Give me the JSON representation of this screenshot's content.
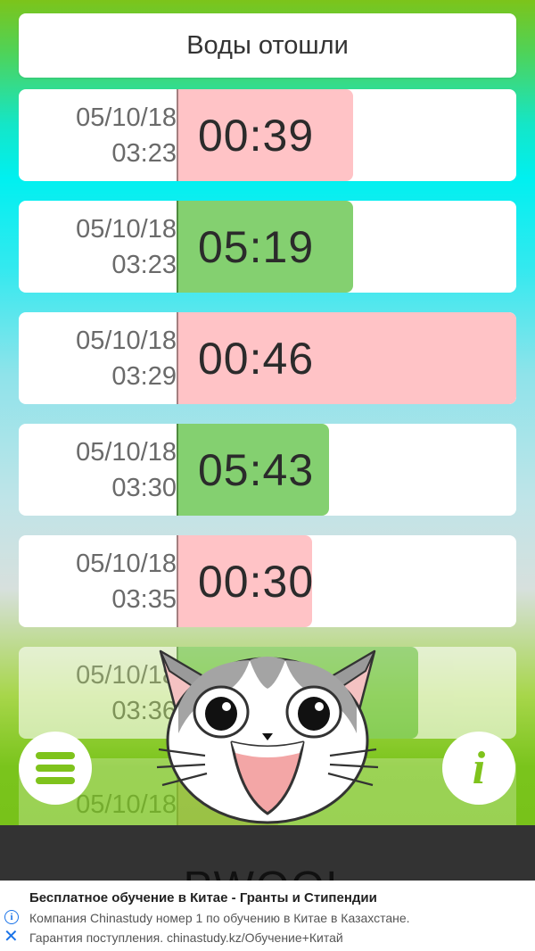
{
  "header": {
    "title": "Воды отошли"
  },
  "entries": [
    {
      "date": "05/10/18",
      "time": "03:23",
      "duration": "00:39",
      "type": "contraction",
      "fraction": 0.52
    },
    {
      "date": "05/10/18",
      "time": "03:23",
      "duration": "05:19",
      "type": "pause",
      "fraction": 0.52
    },
    {
      "date": "05/10/18",
      "time": "03:29",
      "duration": "00:46",
      "type": "contraction",
      "fraction": 1.0
    },
    {
      "date": "05/10/18",
      "time": "03:30",
      "duration": "05:43",
      "type": "pause",
      "fraction": 0.45
    },
    {
      "date": "05/10/18",
      "time": "03:35",
      "duration": "00:30",
      "type": "contraction",
      "fraction": 0.4
    },
    {
      "date": "05/10/18",
      "time": "03:36",
      "duration": "",
      "type": "pause",
      "fraction": 0.71
    },
    {
      "date": "05/10/18",
      "time": "",
      "duration": "",
      "type": "contraction",
      "fraction": 0.3
    }
  ],
  "controls": {
    "menu_icon": "hamburger-icon",
    "info_icon": "info-icon",
    "info_symbol": "i"
  },
  "bottom_button": {
    "label": "PWOOL"
  },
  "ad": {
    "title": "Бесплатное обучение в Китае - Гранты и Стипендии",
    "line1": "Компания Chinastudy номер 1 по обучению в Китае в Казахстане.",
    "line2": "Гарантия поступления. chinastudy.kz/Обучение+Китай",
    "info_symbol": "i",
    "close_symbol": "✕"
  },
  "colors": {
    "contraction": "#ffc3c6",
    "pause": "#84d070",
    "accent": "#7fc31c"
  }
}
